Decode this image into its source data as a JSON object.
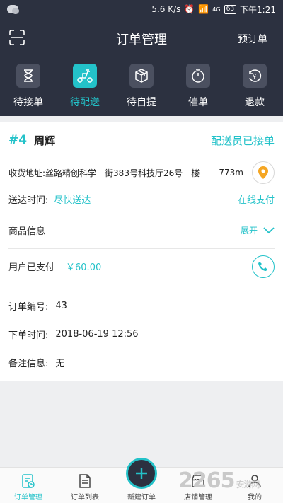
{
  "statusbar": {
    "speed": "5.6 K/s",
    "signal": "4G",
    "battery": "63",
    "time": "下午1:21"
  },
  "header": {
    "title": "订单管理",
    "preorder_label": "预订单"
  },
  "tabs": [
    {
      "label": "待接单",
      "icon": "hourglass-icon"
    },
    {
      "label": "待配送",
      "icon": "scooter-icon"
    },
    {
      "label": "待自提",
      "icon": "box-icon"
    },
    {
      "label": "催单",
      "icon": "timer-icon"
    },
    {
      "label": "退款",
      "icon": "refund-icon"
    }
  ],
  "order": {
    "number": "#4",
    "customer": "周辉",
    "status": "配送员已接单",
    "address": "收货地址:丝路精创科学一街383号科技厅26号一楼",
    "distance": "773m",
    "delivery_time_label": "送达时间:",
    "delivery_time_value": "尽快送达",
    "payment_method": "在线支付",
    "goods_label": "商品信息",
    "expand_label": "展开",
    "paid_label": "用户已支付",
    "paid_amount": "￥60.00",
    "order_id_label": "订单编号:",
    "order_id": "43",
    "order_time_label": "下单时间:",
    "order_time": "2018-06-19 12:56",
    "note_label": "备注信息:",
    "note": "无"
  },
  "bottom_nav": [
    {
      "label": "订单管理",
      "icon": "order-manage-icon"
    },
    {
      "label": "订单列表",
      "icon": "order-list-icon"
    },
    {
      "label": "新建订单",
      "icon": "plus-icon"
    },
    {
      "label": "店铺管理",
      "icon": "store-icon"
    },
    {
      "label": "我的",
      "icon": "user-icon"
    }
  ],
  "watermark": {
    "logo": "2265",
    "sub": "安游网"
  },
  "colors": {
    "accent": "#23c2c9",
    "dark": "#2c3140",
    "location": "#f5a623"
  }
}
